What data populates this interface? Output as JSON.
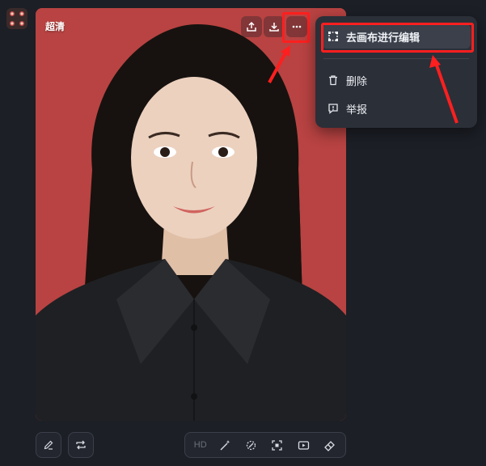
{
  "image": {
    "quality_badge": "超清"
  },
  "top_actions": {
    "icons": [
      "share-icon",
      "download-icon",
      "more-icon"
    ]
  },
  "menu": {
    "items": [
      {
        "label": "去画布进行编辑",
        "icon": "canvas-edit-icon"
      },
      {
        "label": "删除",
        "icon": "trash-icon"
      },
      {
        "label": "举报",
        "icon": "report-icon"
      }
    ]
  },
  "toolbar": {
    "hd_label": "HD",
    "icons": [
      "magic-wand-icon",
      "erase-icon",
      "crop-icon",
      "video-icon",
      "eraser-icon"
    ]
  },
  "bottom_left": {
    "icons": [
      "edit-icon",
      "regenerate-icon"
    ]
  },
  "colors": {
    "background": "#1c1f26",
    "photo_background": "#b84342",
    "menu_background": "#2b2f38",
    "highlight": "#ff1f1f"
  }
}
